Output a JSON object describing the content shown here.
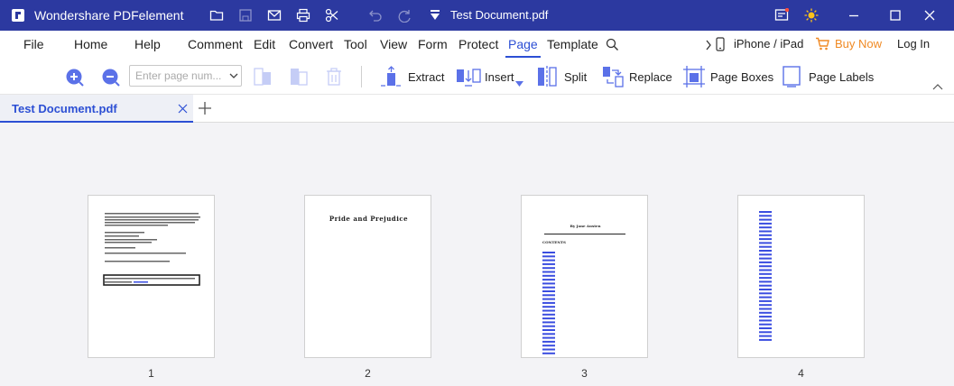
{
  "titlebar": {
    "app_name": "Wondershare PDFelement",
    "document_title": "Test Document.pdf"
  },
  "menubar": {
    "items": [
      "File",
      "Home",
      "Help",
      "Comment",
      "Edit",
      "Convert",
      "Tool",
      "View",
      "Form",
      "Protect",
      "Page",
      "Template"
    ],
    "active": "Page",
    "iphone_ipad": "iPhone / iPad",
    "buy_now": "Buy Now",
    "log_in": "Log In"
  },
  "toolbar": {
    "page_input_placeholder": "Enter page num...",
    "extract": "Extract",
    "insert": "Insert",
    "split": "Split",
    "replace": "Replace",
    "page_boxes": "Page Boxes",
    "page_labels": "Page Labels"
  },
  "tabs": [
    {
      "label": "Test Document.pdf"
    }
  ],
  "pages": [
    {
      "number": "1"
    },
    {
      "number": "2",
      "heading": "Pride and Prejudice"
    },
    {
      "number": "3",
      "heading": "By Jane Austen",
      "subheading": "CONTENTS"
    },
    {
      "number": "4"
    }
  ],
  "colors": {
    "titlebar": "#2c39a0",
    "accent": "#2c4fd4",
    "buy_now": "#f08a24",
    "toc_link": "#3a4de0"
  }
}
